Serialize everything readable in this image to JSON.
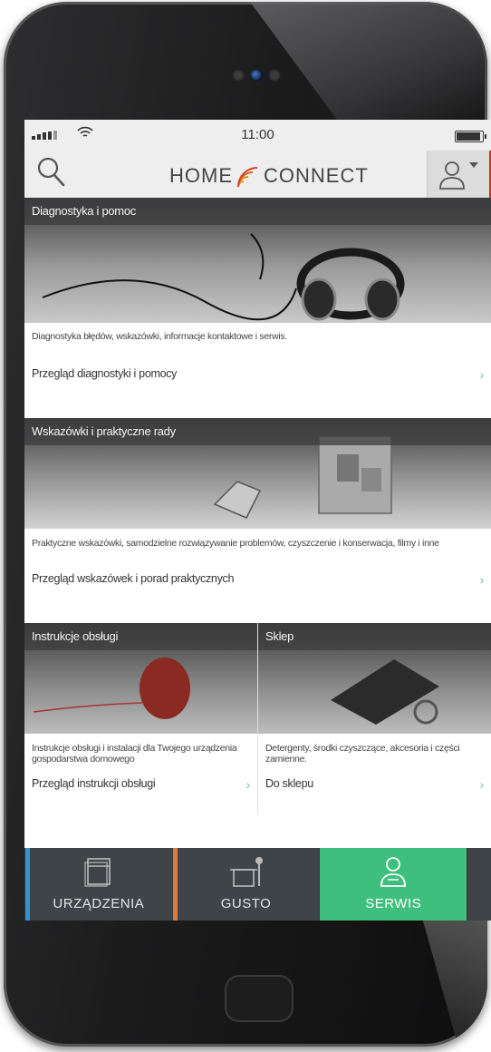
{
  "colors": {
    "accent_green": "#3fbf7d",
    "tab_bar": "#3f4449",
    "tab_devices_accent": "#3a8dd8",
    "tab_gusto_accent": "#e07a3a",
    "chevron": "#7fb6a8"
  },
  "status_bar": {
    "time": "11:00"
  },
  "header": {
    "logo_left": "Home",
    "logo_right": "connecT",
    "search_icon": "search-icon",
    "profile_icon": "user-icon"
  },
  "cards": [
    {
      "title": "Diagnostyka i pomoc",
      "description": "Diagnostyka błędów, wskazówki, informacje kontaktowe i serwis.",
      "link": "Przegląd diagnostyki i pomocy"
    },
    {
      "title": "Wskazówki i praktyczne rady",
      "description": "Praktyczne wskazówki, samodzielne rozwiązywanie problemów, czyszczenie i konserwacja, filmy i inne",
      "link": "Przegląd wskazówek i porad praktycznych"
    },
    {
      "title": "Instrukcje obsługi",
      "description": "Instrukcje obsługi i instalacji dla Twojego urządzenia gospodarstwa domowego",
      "link": "Przegląd instrukcji obsługi"
    },
    {
      "title": "Sklep",
      "description": "Detergenty, środki czyszczące, akcesoria i części zamienne.",
      "link": "Do sklepu"
    }
  ],
  "tabs": [
    {
      "label": "URZĄDZENIA",
      "icon": "appliances-icon"
    },
    {
      "label": "GUSTO",
      "icon": "cooking-pot-icon"
    },
    {
      "label": "SERWIS",
      "icon": "service-user-icon",
      "active": true
    }
  ]
}
